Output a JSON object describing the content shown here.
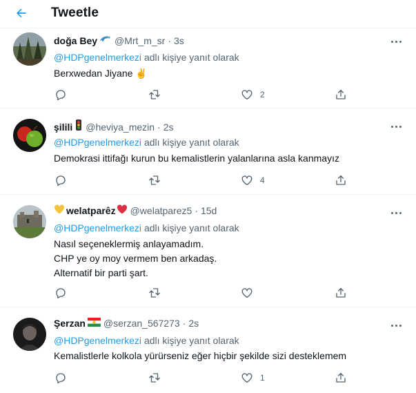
{
  "header": {
    "title": "Tweetle",
    "back_icon": "arrow-left-icon",
    "accent": "#1d9bf0"
  },
  "tweets": [
    {
      "name": "doğa Bey",
      "name_emoji": "dolphin-icon",
      "handle": "@Mrt_m_sr",
      "dot": "·",
      "time": "3s",
      "reply_to": "@HDPgenelmerkezi",
      "reply_suffix": "adlı kişiye yanıt olarak",
      "lines": [
        "Berxwedan Jiyane ✌️"
      ],
      "likes": "2"
    },
    {
      "name": "şilili",
      "name_emoji": "traffic-light-icon",
      "handle": "@heviya_mezin",
      "dot": "·",
      "time": "2s",
      "reply_to": "@HDPgenelmerkezi",
      "reply_suffix": "adlı kişiye yanıt olarak",
      "lines": [
        "Demokrasi ittifağı kurun bu kemalistlerin yalanlarına asla kanmayız"
      ],
      "likes": "4"
    },
    {
      "name": "welatparêz",
      "name_emoji": "yellow-heart-and-red-heart-icon",
      "handle": "@welatparez5",
      "dot": "·",
      "time": "15d",
      "reply_to": "@HDPgenelmerkezi",
      "reply_suffix": "adlı kişiye yanıt olarak",
      "lines": [
        "Nasıl seçeneklermiş anlayamadım.",
        "CHP ye oy moy vermem ben arkadaş.",
        "Alternatif bir parti şart."
      ],
      "likes": ""
    },
    {
      "name": "Şerzan",
      "name_emoji": "kurdistan-flag-icon",
      "handle": "@serzan_567273",
      "dot": "·",
      "time": "2s",
      "reply_to": "@HDPgenelmerkezi",
      "reply_suffix": "adlı kişiye yanıt olarak",
      "lines": [
        "Kemalistlerle kolkola yürürseniz eğer hiçbir şekilde sizi desteklemem"
      ],
      "likes": "1"
    }
  ]
}
